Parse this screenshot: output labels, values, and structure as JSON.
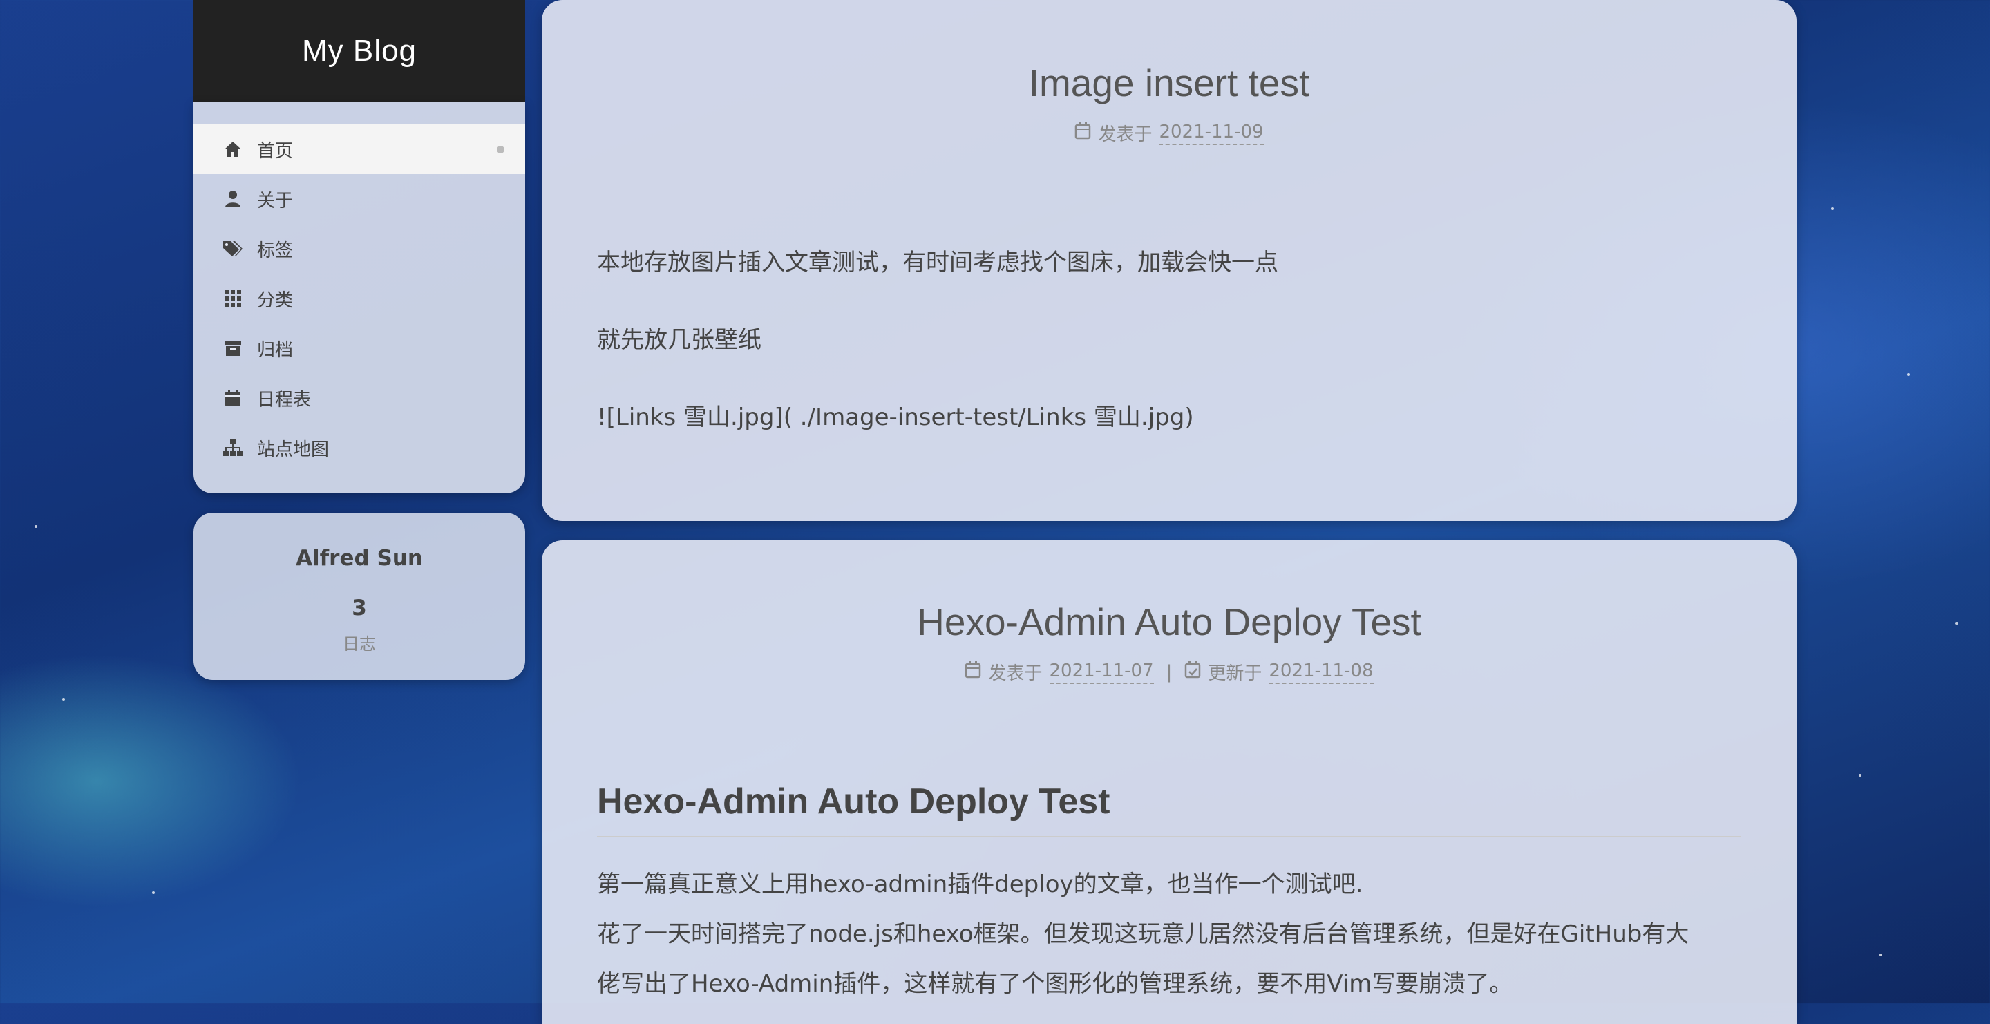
{
  "site": {
    "title": "My Blog"
  },
  "menu": {
    "items": [
      {
        "label": "首页",
        "icon": "home-icon",
        "active": true
      },
      {
        "label": "关于",
        "icon": "user-icon"
      },
      {
        "label": "标签",
        "icon": "tags-icon"
      },
      {
        "label": "分类",
        "icon": "grid-icon"
      },
      {
        "label": "归档",
        "icon": "archive-icon"
      },
      {
        "label": "日程表",
        "icon": "calendar-icon"
      },
      {
        "label": "站点地图",
        "icon": "sitemap-icon"
      }
    ]
  },
  "author": {
    "name": "Alfred Sun",
    "post_count": "3",
    "post_label": "日志"
  },
  "posts": [
    {
      "title": "Image insert test",
      "published_label": "发表于",
      "published_date": "2021-11-09",
      "paragraphs": [
        "本地存放图片插入文章测试，有时间考虑找个图床，加载会快一点",
        "就先放几张壁纸",
        "![Links 雪山.jpg]( ./Image-insert-test/Links 雪山.jpg)"
      ]
    },
    {
      "title": "Hexo-Admin Auto Deploy Test",
      "published_label": "发表于",
      "published_date": "2021-11-07",
      "separator": "|",
      "updated_label": "更新于",
      "updated_date": "2021-11-08",
      "heading": "Hexo-Admin Auto Deploy Test",
      "lines": [
        "第一篇真正意义上用hexo-admin插件deploy的文章，也当作一个测试吧.",
        "花了一天时间搭完了node.js和hexo框架。但发现这玩意儿居然没有后台管理系统，但是好在GitHub有大",
        "佬写出了Hexo-Admin插件，这样就有了个图形化的管理系统，要不用Vim写要崩溃了。"
      ]
    }
  ],
  "colors": {
    "brand_bg": "#222222",
    "panel_bg": "#e6eaf4",
    "background": "#1a3f8f"
  }
}
